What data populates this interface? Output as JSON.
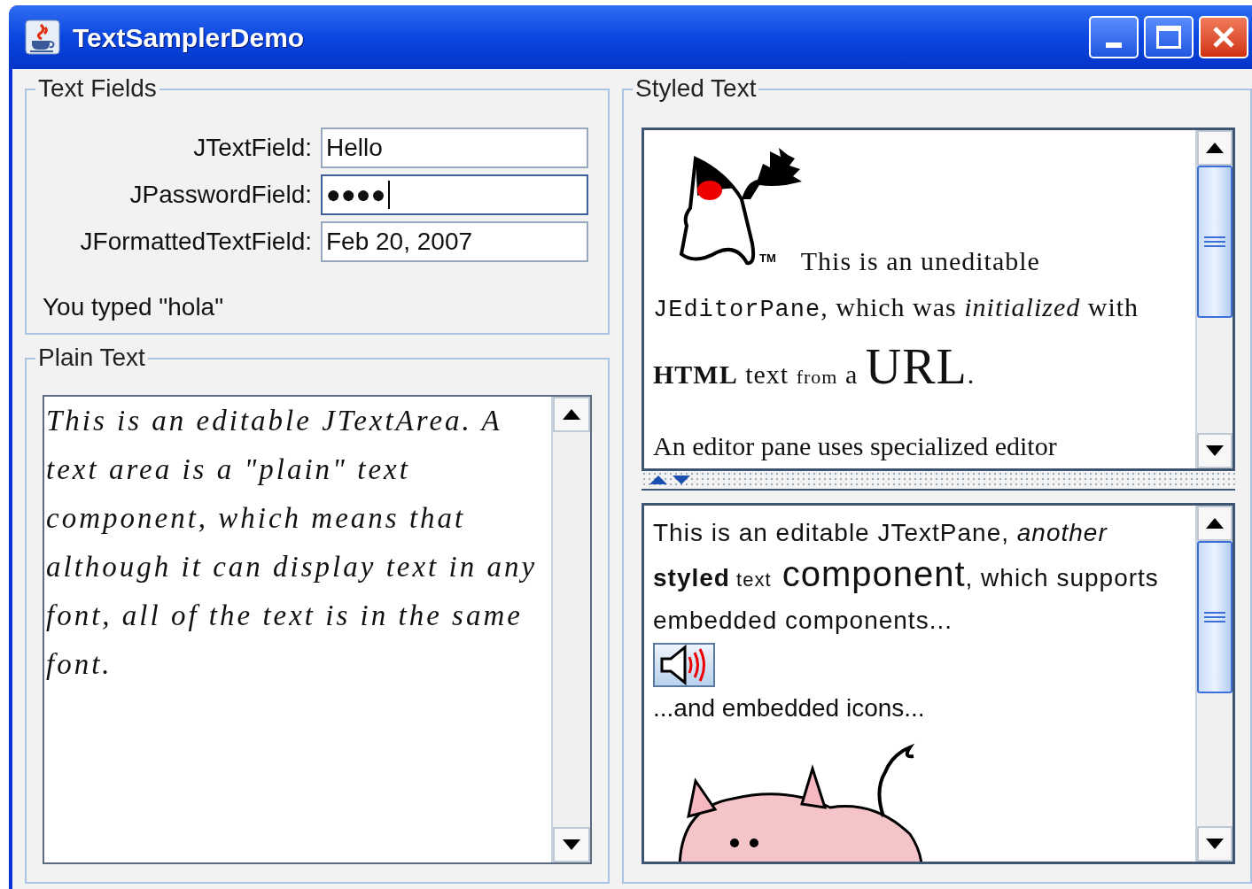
{
  "window": {
    "title": "TextSamplerDemo"
  },
  "text_fields": {
    "title": "Text Fields",
    "fields": [
      {
        "label": "JTextField:",
        "value": "Hello",
        "focused": false
      },
      {
        "label": "JPasswordField:",
        "value": "●●●●",
        "focused": true
      },
      {
        "label": "JFormattedTextField:",
        "value": "Feb 20, 2007",
        "focused": false
      }
    ],
    "message": "You typed \"hola\""
  },
  "plain_text": {
    "title": "Plain Text",
    "text": "This is an editable JTextArea. A text area is a \"plain\" text component, which means that although it can display text in any font, all of the text is in the same font."
  },
  "styled_text": {
    "title": "Styled Text",
    "editor_pane": {
      "trademark": "TM",
      "first_line": "This is an uneditable",
      "segments": [
        {
          "kind": "mono",
          "text": "JEditorPane"
        },
        {
          "kind": "regular",
          "text": ", which was "
        },
        {
          "kind": "italic",
          "text": "initialized"
        },
        {
          "kind": "regular",
          "text": " with "
        },
        {
          "kind": "bold",
          "text": "HTML"
        },
        {
          "kind": "regular",
          "text": " text "
        },
        {
          "kind": "small",
          "text": "from"
        },
        {
          "kind": "regular",
          "text": " a "
        },
        {
          "kind": "large",
          "text": "URL"
        },
        {
          "kind": "regular",
          "text": "."
        }
      ],
      "paragraph_2": "An editor pane uses specialized editor"
    },
    "text_pane": {
      "segments": [
        {
          "kind": "regular",
          "text": "This is an editable JTextPane, "
        },
        {
          "kind": "italic",
          "text": "another"
        },
        {
          "kind": "bold",
          "text": " styled"
        },
        {
          "kind": "small",
          "text": " text"
        },
        {
          "kind": "large",
          "text": " component"
        },
        {
          "kind": "regular",
          "text": ", which supports embedded components..."
        }
      ],
      "after_button": "...and embedded icons..."
    }
  }
}
